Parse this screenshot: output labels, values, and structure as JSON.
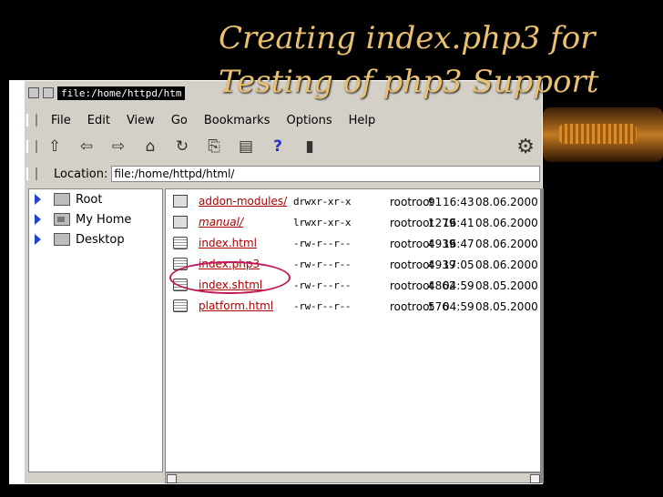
{
  "window": {
    "title_field": "file:/home/httpd/htm"
  },
  "menu": {
    "items": [
      {
        "label": "File",
        "key": "F"
      },
      {
        "label": "Edit",
        "key": "E"
      },
      {
        "label": "View",
        "key": "V"
      },
      {
        "label": "Go",
        "key": "G"
      },
      {
        "label": "Bookmarks",
        "key": "B"
      },
      {
        "label": "Options",
        "key": "O"
      },
      {
        "label": "Help",
        "key": "H"
      }
    ]
  },
  "toolbar": {
    "up_icon": "⇧",
    "back_icon": "⇦",
    "forward_icon": "⇨",
    "home_icon": "⌂",
    "reload_icon": "↻",
    "copy_icon": "⎘",
    "paste_icon": "▤",
    "help_icon": "?",
    "stop_icon": "▮",
    "settings_icon": "⚙"
  },
  "location": {
    "label": "Location:",
    "value": "file:/home/httpd/html/"
  },
  "tree": {
    "items": [
      {
        "label": "Root",
        "icon": "folder-icon"
      },
      {
        "label": "My Home",
        "icon": "home-icon"
      },
      {
        "label": "Desktop",
        "icon": "desktop-icon"
      }
    ]
  },
  "files": {
    "rows": [
      {
        "name": "addon-modules/",
        "perm": "drwxr-xr-x",
        "owner": "rootroot",
        "size": "91",
        "time": "16:43",
        "date": "08.06.2000",
        "type": "folder",
        "italic": false
      },
      {
        "name": "manual/",
        "perm": "lrwxr-xr-x",
        "owner": "rootroot",
        "size": "1279",
        "time": "16:41",
        "date": "08.06.2000",
        "type": "folder",
        "italic": true
      },
      {
        "name": "index.html",
        "perm": "-rw-r--r--",
        "owner": "rootroot",
        "size": "4939",
        "time": "16:47",
        "date": "08.06.2000",
        "type": "doc",
        "italic": false
      },
      {
        "name": "index.php3",
        "perm": "-rw-r--r--",
        "owner": "rootroot",
        "size": "4939",
        "time": "17:05",
        "date": "08.06.2000",
        "type": "doc",
        "italic": false
      },
      {
        "name": "index.shtml",
        "perm": "-rw-r--r--",
        "owner": "rootroot",
        "size": "4862",
        "time": "04:59",
        "date": "08.05.2000",
        "type": "doc",
        "italic": false
      },
      {
        "name": "platform.html",
        "perm": "-rw-r--r--",
        "owner": "rootroot",
        "size": "576",
        "time": "04:59",
        "date": "08.05.2000",
        "type": "doc",
        "italic": false
      }
    ]
  },
  "slide": {
    "title_line1": "Creating index.php3 for",
    "title_line2": "Testing of php3 Support"
  },
  "colors": {
    "title_text": "#e8c070",
    "highlight_ring": "#c2185b",
    "link_text": "#aa0000"
  }
}
